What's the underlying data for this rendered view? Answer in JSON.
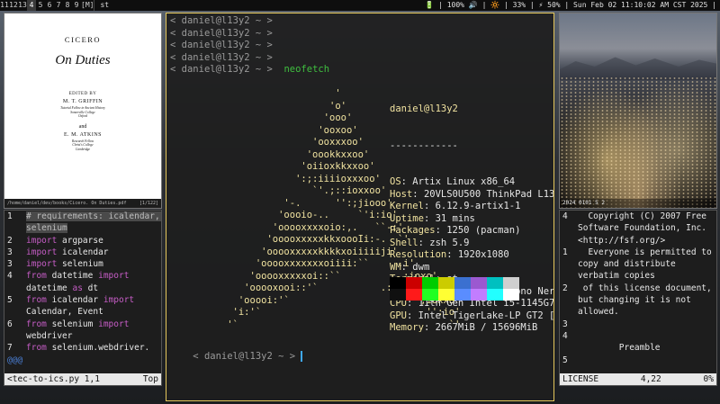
{
  "bar": {
    "tags": [
      "1",
      "2",
      "3",
      "4",
      "5",
      "6",
      "7",
      "8",
      "9"
    ],
    "tag_superscripts": [
      "1",
      "1",
      "1",
      "",
      "",
      "",
      "",
      "",
      ""
    ],
    "selected_tag_index": 3,
    "layout": "[M]",
    "window_title": "st",
    "status": "🔋 | 100% 🔊 | 🔆 | 33% | ⚡ 50% | Sun Feb 02 11:10:02 AM CST 2025 |"
  },
  "pdf": {
    "author": "CICERO",
    "title": "On Duties",
    "edited_by": "EDITED BY",
    "editor1": "M. T. GRIFFIN",
    "editor1_aff": [
      "Tutorial Fellow in Ancient History",
      "Somerville College",
      "Oxford"
    ],
    "and": "and",
    "editor2": "E. M. ATKINS",
    "editor2_aff": [
      "Research Fellow",
      "Christ's College",
      "Cambridge"
    ],
    "path": "/home/daniel/dev/books/Cicero. On Duties.pdf",
    "page": "[1/122]"
  },
  "vim": {
    "lines": [
      {
        "n": "1",
        "parts": [
          {
            "t": "# requirements: icalendar, selenium",
            "c": "cm hl"
          }
        ]
      },
      {
        "n": "2",
        "parts": [
          {
            "t": "import",
            "c": "kw"
          },
          {
            "t": " argparse",
            "c": ""
          }
        ]
      },
      {
        "n": "3",
        "parts": [
          {
            "t": "import",
            "c": "kw"
          },
          {
            "t": " icalendar",
            "c": ""
          }
        ]
      },
      {
        "n": "3",
        "parts": [
          {
            "t": "import",
            "c": "kw"
          },
          {
            "t": " selenium",
            "c": ""
          }
        ]
      },
      {
        "n": "4",
        "parts": [
          {
            "t": "from",
            "c": "kw"
          },
          {
            "t": " datetime ",
            "c": ""
          },
          {
            "t": "import",
            "c": "kw"
          },
          {
            "t": " datetime ",
            "c": ""
          },
          {
            "t": "as",
            "c": "kw"
          },
          {
            "t": " dt",
            "c": ""
          }
        ]
      },
      {
        "n": "5",
        "parts": [
          {
            "t": "from",
            "c": "kw"
          },
          {
            "t": " icalendar ",
            "c": ""
          },
          {
            "t": "import",
            "c": "kw"
          },
          {
            "t": " Calendar, Event",
            "c": ""
          }
        ]
      },
      {
        "n": "6",
        "parts": [
          {
            "t": "from",
            "c": "kw"
          },
          {
            "t": " selenium ",
            "c": ""
          },
          {
            "t": "import",
            "c": "kw"
          },
          {
            "t": " webdriver",
            "c": ""
          }
        ]
      },
      {
        "n": "7",
        "parts": [
          {
            "t": "from",
            "c": "kw"
          },
          {
            "t": " selenium.webdriver.",
            "c": ""
          }
        ]
      }
    ],
    "tail": "@@@",
    "status_file": "<tec-to-ics.py 1,1",
    "status_pos": "Top"
  },
  "term": {
    "prompt_user": "daniel",
    "prompt_at": "@",
    "prompt_host": "l13y2",
    "prompt_tail": " ~ >",
    "prompt_open": "< ",
    "command": "neofetch",
    "art": [
      "                             '",
      "                            'o'",
      "                           'ooo'",
      "                          'ooxoo'",
      "                         'ooxxxoo'",
      "                        'oookkxxoo'",
      "                       'oiioxkkxxoo'",
      "                      ':;:iiiioxxxoo'",
      "                         `'.;::ioxxoo'",
      "                    '-.      '':;jiooo'",
      "                   'oooio-..     `'i:io'",
      "                  'ooooxxxxoio:,.   ``-;'",
      "                 'ooooxxxxxkkxoooIi:-.  `'",
      "                'ooooxxxxxkkkkxoiiiiiji'",
      "               'ooooxxxxxxxoiiii:``     .i'",
      "              'ooooxxxxxoi::``          .;ioxo'",
      "             'ooooxooi::'`           .:iiixkxxo'",
      "            'ooooi:'`                    `'';ioxxo'",
      "           'i:'`                             '':io'",
      "          '`                                     `'"
    ],
    "header": "daniel@l13y2",
    "dashes": "------------",
    "info": [
      {
        "k": "OS",
        "v": "Artix Linux x86_64"
      },
      {
        "k": "Host",
        "v": "20VLS0U500 ThinkPad L13"
      },
      {
        "k": "Kernel",
        "v": "6.12.9-artix1-1"
      },
      {
        "k": "Uptime",
        "v": "31 mins"
      },
      {
        "k": "Packages",
        "v": "1250 (pacman)"
      },
      {
        "k": "Shell",
        "v": "zsh 5.9"
      },
      {
        "k": "Resolution",
        "v": "1920x1080"
      },
      {
        "k": "WM",
        "v": "dwm"
      },
      {
        "k": "Terminal",
        "v": "st"
      },
      {
        "k": "Terminal Font",
        "v": "RobotoMono Nerd"
      },
      {
        "k": "CPU",
        "v": "11th Gen Intel i5-1145G7"
      },
      {
        "k": "GPU",
        "v": "Intel TigerLake-LP GT2 [I"
      },
      {
        "k": "Memory",
        "v": "2667MiB / 15696MiB"
      }
    ],
    "colors_top": [
      "#000000",
      "#cc0000",
      "#00cc00",
      "#cccc00",
      "#3b70d0",
      "#9b59d0",
      "#00c0c0",
      "#cfcfcf"
    ],
    "colors_bottom": [
      "#101010",
      "#ff1a1a",
      "#22ff22",
      "#ffff33",
      "#5a8dff",
      "#c27dff",
      "#22ffff",
      "#ffffff"
    ]
  },
  "photo": {
    "caption": "2024 0101 5 2"
  },
  "license": {
    "lines": [
      {
        "n": "4",
        "t": "  Copyright (C) 2007 Free Software Foundation, Inc. <http://fsf.org/>"
      },
      {
        "n": "1",
        "t": "  Everyone is permitted to copy and distribute verbatim copies"
      },
      {
        "n": "2",
        "t": " of this license document, but changing it is not allowed."
      },
      {
        "n": "3",
        "t": ""
      },
      {
        "n": "4",
        "t": ""
      },
      {
        "n": "",
        "t": "        Preamble"
      },
      {
        "n": "5",
        "t": ""
      }
    ],
    "status_file": "LICENSE",
    "status_pos": "4,22",
    "status_pct": "0%"
  }
}
